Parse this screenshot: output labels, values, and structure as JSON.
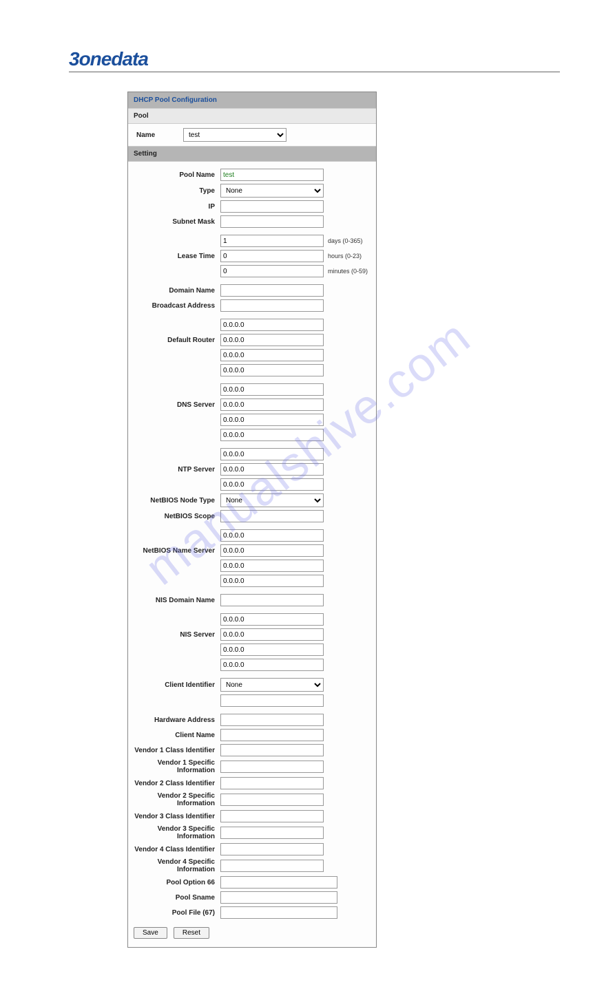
{
  "brand": "3onedata",
  "watermark": "manualshive.com",
  "panel_title": "DHCP Pool Configuration",
  "pool_section": "Pool",
  "setting_section": "Setting",
  "pool_name_label": "Name",
  "pool_name_value": "test",
  "fields": {
    "pool_name": {
      "label": "Pool Name",
      "value": "test"
    },
    "type": {
      "label": "Type",
      "value": "None"
    },
    "ip": {
      "label": "IP",
      "value": ""
    },
    "subnet_mask": {
      "label": "Subnet Mask",
      "value": ""
    },
    "lease_time": {
      "label": "Lease Time",
      "days": "1",
      "days_suffix": "days (0-365)",
      "hours": "0",
      "hours_suffix": "hours (0-23)",
      "minutes": "0",
      "minutes_suffix": "minutes (0-59)"
    },
    "domain_name": {
      "label": "Domain Name",
      "value": ""
    },
    "broadcast_address": {
      "label": "Broadcast Address",
      "value": ""
    },
    "default_router": {
      "label": "Default Router",
      "values": [
        "0.0.0.0",
        "0.0.0.0",
        "0.0.0.0",
        "0.0.0.0"
      ]
    },
    "dns_server": {
      "label": "DNS Server",
      "values": [
        "0.0.0.0",
        "0.0.0.0",
        "0.0.0.0",
        "0.0.0.0"
      ]
    },
    "ntp_server": {
      "label": "NTP Server",
      "values": [
        "0.0.0.0",
        "0.0.0.0",
        "0.0.0.0"
      ]
    },
    "netbios_node_type": {
      "label": "NetBIOS Node Type",
      "value": "None"
    },
    "netbios_scope": {
      "label": "NetBIOS Scope",
      "value": ""
    },
    "netbios_name_server": {
      "label": "NetBIOS Name Server",
      "values": [
        "0.0.0.0",
        "0.0.0.0",
        "0.0.0.0",
        "0.0.0.0"
      ]
    },
    "nis_domain_name": {
      "label": "NIS Domain Name",
      "value": ""
    },
    "nis_server": {
      "label": "NIS Server",
      "values": [
        "0.0.0.0",
        "0.0.0.0",
        "0.0.0.0",
        "0.0.0.0"
      ]
    },
    "client_identifier": {
      "label": "Client Identifier",
      "select": "None",
      "text": ""
    },
    "hardware_address": {
      "label": "Hardware Address",
      "value": ""
    },
    "client_name": {
      "label": "Client Name",
      "value": ""
    },
    "v1ci": {
      "label": "Vendor 1 Class Identifier",
      "value": ""
    },
    "v1si": {
      "label": "Vendor 1 Specific Information",
      "value": ""
    },
    "v2ci": {
      "label": "Vendor 2 Class Identifier",
      "value": ""
    },
    "v2si": {
      "label": "Vendor 2 Specific Information",
      "value": ""
    },
    "v3ci": {
      "label": "Vendor 3 Class Identifier",
      "value": ""
    },
    "v3si": {
      "label": "Vendor 3 Specific Information",
      "value": ""
    },
    "v4ci": {
      "label": "Vendor 4 Class Identifier",
      "value": ""
    },
    "v4si": {
      "label": "Vendor 4 Specific Information",
      "value": ""
    },
    "pool_option_66": {
      "label": "Pool Option 66",
      "value": ""
    },
    "pool_sname": {
      "label": "Pool Sname",
      "value": ""
    },
    "pool_file_67": {
      "label": "Pool File (67)",
      "value": ""
    }
  },
  "buttons": {
    "save": "Save",
    "reset": "Reset"
  }
}
